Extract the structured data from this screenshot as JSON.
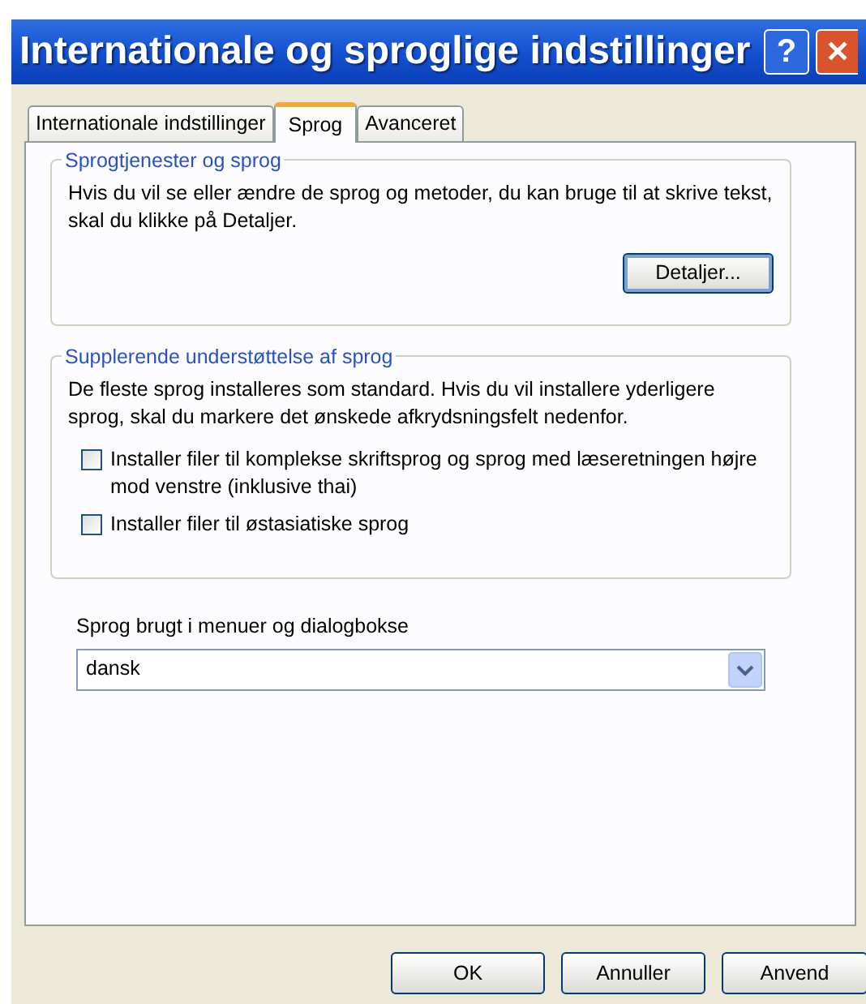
{
  "window": {
    "title": "Internationale og sproglige indstillinger",
    "help": "?",
    "close": "✕"
  },
  "tabs": [
    {
      "label": "Internationale indstillinger",
      "selected": false
    },
    {
      "label": "Sprog",
      "selected": true
    },
    {
      "label": "Avanceret",
      "selected": false
    }
  ],
  "group_1": {
    "title": "Sprogtjenester og sprog",
    "text": "Hvis du vil se eller ændre de sprog og metoder, du kan bruge til at skrive tekst, skal du klikke på Detaljer.",
    "button": "Detaljer..."
  },
  "group_2": {
    "title": "Supplerende understøttelse af sprog",
    "text": "De fleste sprog installeres som standard. Hvis du vil installere yderligere sprog, skal du markere det ønskede afkrydsningsfelt nedenfor.",
    "checkboxes": [
      {
        "label": "Installer filer til komplekse skriftsprog og sprog med læseretningen højre mod venstre (inklusive thai)",
        "checked": false
      },
      {
        "label": "Installer filer til østasiatiske sprog",
        "checked": false
      }
    ]
  },
  "menu_language": {
    "label": "Sprog brugt i menuer og dialogbokse",
    "value": "dansk"
  },
  "buttons": [
    "OK",
    "Annuller",
    "Anvend"
  ]
}
